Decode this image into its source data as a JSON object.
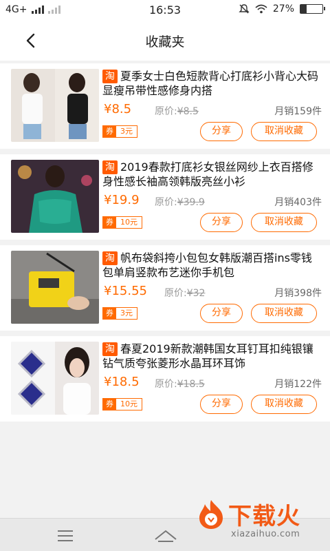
{
  "status_bar": {
    "network": "4G+",
    "time": "16:53",
    "battery": "27%",
    "battery_level": 0.27
  },
  "header": {
    "title": "收藏夹"
  },
  "items": [
    {
      "title": "夏季女士白色短款背心打底衫小背心大码显瘦吊带性感修身内搭",
      "price": "¥8.5",
      "orig_label": "原价:",
      "orig_price": "¥8.5",
      "sales": "月销159件",
      "coupon_label": "券",
      "coupon_amount": "3元",
      "share": "分享",
      "cancel": "取消收藏"
    },
    {
      "title": "2019春款打底衫女银丝网纱上衣百搭修身性感长袖高领韩版亮丝小衫",
      "price": "¥19.9",
      "orig_label": "原价:",
      "orig_price": "¥39.9",
      "sales": "月销403件",
      "coupon_label": "券",
      "coupon_amount": "10元",
      "share": "分享",
      "cancel": "取消收藏"
    },
    {
      "title": "帆布袋斜挎小包包女韩版潮百搭ins零钱包单肩竖款布艺迷你手机包",
      "price": "¥15.55",
      "orig_label": "原价:",
      "orig_price": "¥32",
      "sales": "月销398件",
      "coupon_label": "券",
      "coupon_amount": "3元",
      "share": "分享",
      "cancel": "取消收藏"
    },
    {
      "title": "春夏2019新款潮韩国女耳钉耳扣纯银镶钻气质夸张菱形水晶耳环耳饰",
      "price": "¥18.5",
      "orig_label": "原价:",
      "orig_price": "¥18.5",
      "sales": "月销122件",
      "coupon_label": "券",
      "coupon_amount": "10元",
      "share": "分享",
      "cancel": "取消收藏"
    }
  ],
  "tao_badge": "淘",
  "watermark": {
    "title": "下载火",
    "url": "xiazaihuo.com"
  },
  "colors": {
    "accent": "#ff6a00",
    "badge": "#ff5a00"
  }
}
